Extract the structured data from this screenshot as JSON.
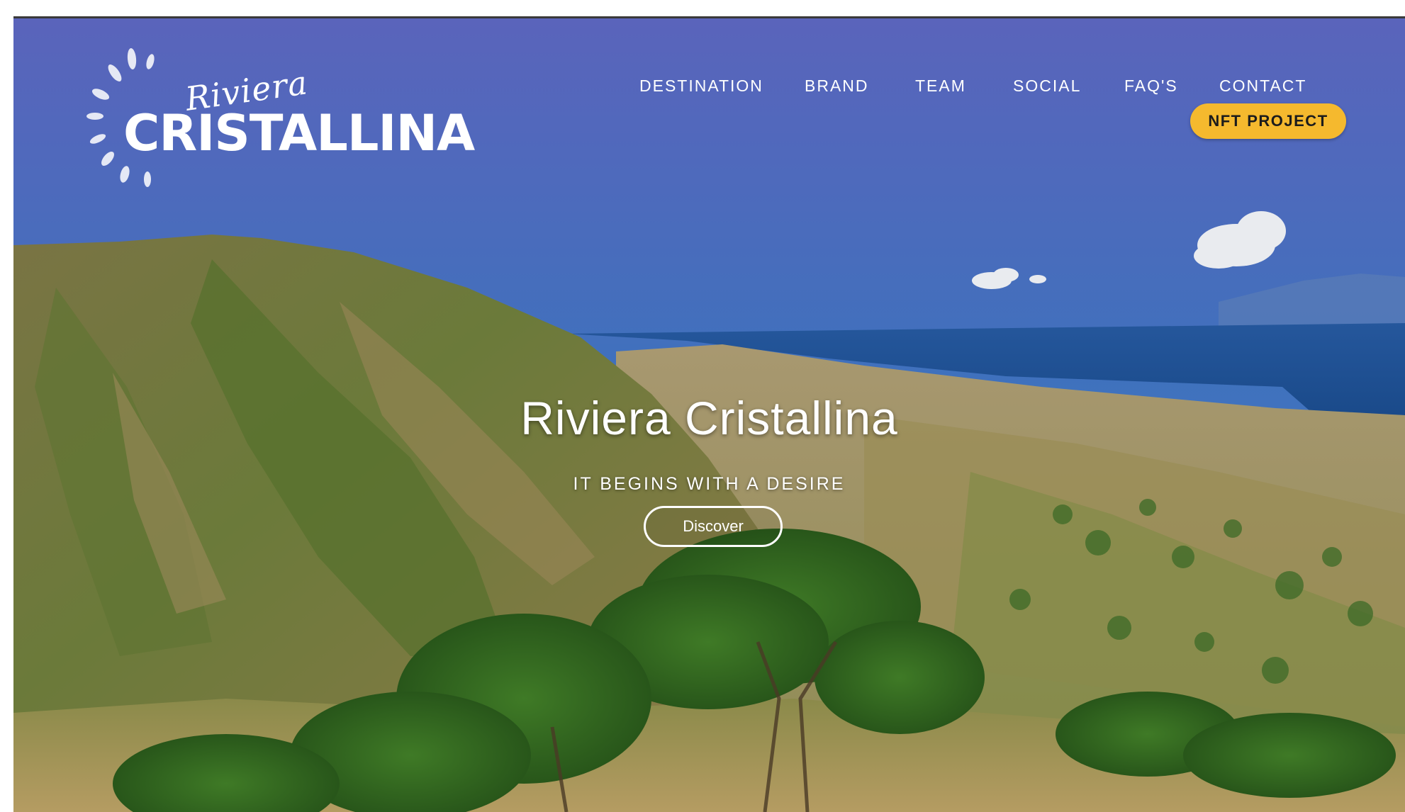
{
  "logo": {
    "script_text": "Riviera",
    "main_text": "CRISTALLINA"
  },
  "nav": {
    "items": [
      {
        "label": "DESTINATION"
      },
      {
        "label": "BRAND"
      },
      {
        "label": "TEAM"
      },
      {
        "label": "SOCIAL"
      },
      {
        "label": "FAQ'S"
      },
      {
        "label": "CONTACT"
      }
    ],
    "cta_label": "NFT PROJECT"
  },
  "hero": {
    "title": "Riviera Cristallina",
    "subtitle": "IT BEGINS WITH A DESIRE",
    "button_label": "Discover"
  },
  "colors": {
    "sky_top": "#5a64bb",
    "sky_bottom": "#3a7fc4",
    "sea": "#1f4f93",
    "cta_yellow": "#f5b92e",
    "text": "#ffffff"
  }
}
